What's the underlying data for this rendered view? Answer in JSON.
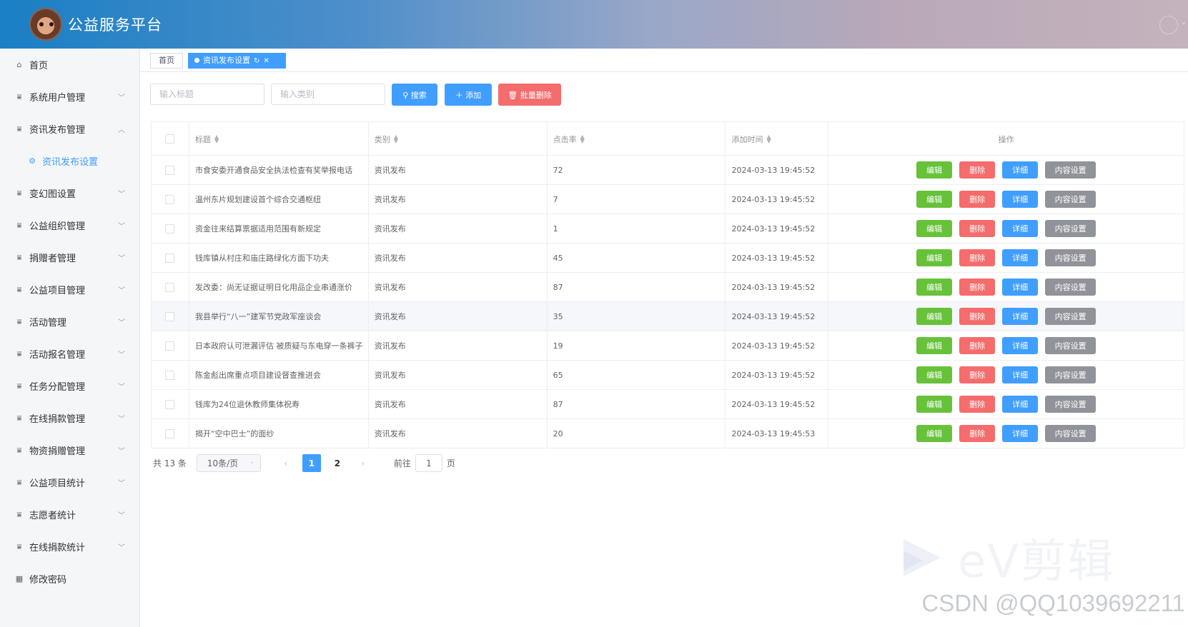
{
  "header": {
    "app_title": "公益服务平台"
  },
  "sidebar": {
    "items": [
      {
        "label": "首页",
        "icon": "home-icon",
        "arrow": ""
      },
      {
        "label": "系统用户管理",
        "icon": "chart-icon",
        "arrow": "down"
      },
      {
        "label": "资讯发布管理",
        "icon": "chart-icon",
        "arrow": "up"
      },
      {
        "label": "资讯发布设置",
        "icon": "gear-icon",
        "arrow": "",
        "sub": true
      },
      {
        "label": "变幻图设置",
        "icon": "chart-icon",
        "arrow": "down"
      },
      {
        "label": "公益组织管理",
        "icon": "chart-icon",
        "arrow": "down"
      },
      {
        "label": "捐赠者管理",
        "icon": "chart-icon",
        "arrow": "down"
      },
      {
        "label": "公益项目管理",
        "icon": "chart-icon",
        "arrow": "down"
      },
      {
        "label": "活动管理",
        "icon": "chart-icon",
        "arrow": "down"
      },
      {
        "label": "活动报名管理",
        "icon": "chart-icon",
        "arrow": "down"
      },
      {
        "label": "任务分配管理",
        "icon": "chart-icon",
        "arrow": "down"
      },
      {
        "label": "在线捐款管理",
        "icon": "chart-icon",
        "arrow": "down"
      },
      {
        "label": "物资捐赠管理",
        "icon": "chart-icon",
        "arrow": "down"
      },
      {
        "label": "公益项目统计",
        "icon": "chart-icon",
        "arrow": "down"
      },
      {
        "label": "志愿者统计",
        "icon": "chart-icon",
        "arrow": "down"
      },
      {
        "label": "在线捐款统计",
        "icon": "chart-icon",
        "arrow": "down"
      },
      {
        "label": "修改密码",
        "icon": "grid-icon",
        "arrow": ""
      }
    ]
  },
  "tabs": {
    "home": "首页",
    "active": "资讯发布设置"
  },
  "toolbar": {
    "title_placeholder": "输入标题",
    "category_placeholder": "输入类别",
    "search_label": "搜索",
    "add_label": "添加",
    "batch_delete_label": "批量删除"
  },
  "table": {
    "headers": {
      "title": "标题",
      "category": "类别",
      "clicks": "点击率",
      "time": "添加时间",
      "ops": "操作"
    },
    "ops": {
      "edit": "编辑",
      "delete": "删除",
      "detail": "详细",
      "content": "内容设置"
    },
    "rows": [
      {
        "title": "市食安委开通食品安全执法检查有奖举报电话",
        "category": "资讯发布",
        "clicks": "72",
        "time": "2024-03-13 19:45:52"
      },
      {
        "title": "温州东片规划建设首个综合交通枢纽",
        "category": "资讯发布",
        "clicks": "7",
        "time": "2024-03-13 19:45:52"
      },
      {
        "title": "资金往来结算票据适用范围有新规定",
        "category": "资讯发布",
        "clicks": "1",
        "time": "2024-03-13 19:45:52"
      },
      {
        "title": "钱库镇从村庄和庙庄路绿化方面下功夫",
        "category": "资讯发布",
        "clicks": "45",
        "time": "2024-03-13 19:45:52"
      },
      {
        "title": "发改委：尚无证据证明日化用品企业串通涨价",
        "category": "资讯发布",
        "clicks": "87",
        "time": "2024-03-13 19:45:52"
      },
      {
        "title": "我县举行“八一”建军节党政军座谈会",
        "category": "资讯发布",
        "clicks": "35",
        "time": "2024-03-13 19:45:52"
      },
      {
        "title": "日本政府认可泄漏评估 被质疑与东电穿一条裤子",
        "category": "资讯发布",
        "clicks": "19",
        "time": "2024-03-13 19:45:52"
      },
      {
        "title": "陈金彪出席重点项目建设督查推进会",
        "category": "资讯发布",
        "clicks": "65",
        "time": "2024-03-13 19:45:52"
      },
      {
        "title": "钱库为24位退休教师集体祝寿",
        "category": "资讯发布",
        "clicks": "87",
        "time": "2024-03-13 19:45:52"
      },
      {
        "title": "揭开“空中巴士”的面纱",
        "category": "资讯发布",
        "clicks": "20",
        "time": "2024-03-13 19:45:53"
      }
    ]
  },
  "pagination": {
    "total": "共 13 条",
    "page_size": "10条/页",
    "pages": [
      "1",
      "2"
    ],
    "current": "1",
    "goto_prefix": "前往",
    "goto_value": "1",
    "goto_suffix": "页"
  },
  "watermarks": {
    "ev": "eV剪辑",
    "csdn": "CSDN @QQ1039692211"
  },
  "colors": {
    "primary": "#409eff",
    "success": "#67c23a",
    "danger": "#f56c6c",
    "info": "#909399"
  }
}
